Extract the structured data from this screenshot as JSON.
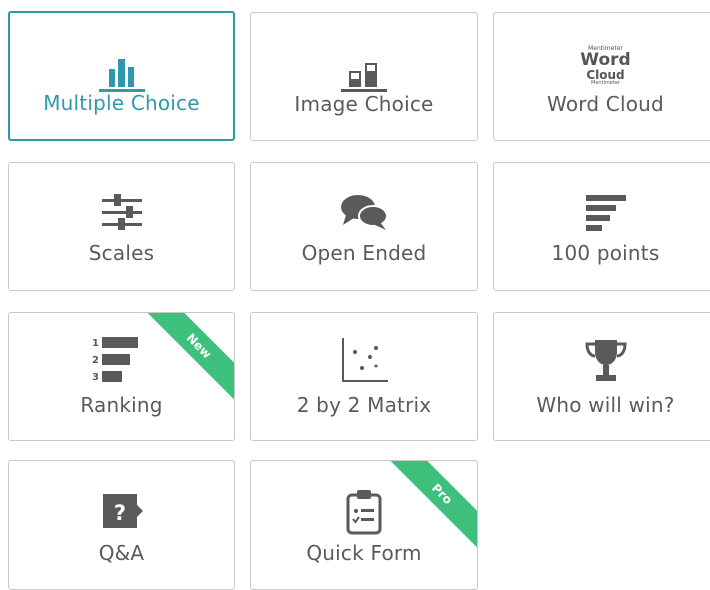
{
  "colors": {
    "accent": "#2e9aa9",
    "ribbon": "#3cc07b",
    "icon": "#555555",
    "border": "#c9c9c9"
  },
  "tiles": [
    {
      "label": "Multiple Choice",
      "icon": "bar-chart-icon",
      "selected": true
    },
    {
      "label": "Image Choice",
      "icon": "image-choice-icon"
    },
    {
      "label": "Word Cloud",
      "icon": "word-cloud-icon",
      "icon_text": {
        "line1": "Mentimeter",
        "line2": "Word",
        "line3": "Cloud",
        "line4": "Mentimeter"
      }
    },
    {
      "label": "Scales",
      "icon": "sliders-icon"
    },
    {
      "label": "Open Ended",
      "icon": "speech-bubbles-icon"
    },
    {
      "label": "100 points",
      "icon": "horizontal-bars-icon"
    },
    {
      "label": "Ranking",
      "icon": "ranking-icon",
      "badge": "New",
      "icon_numbers": [
        "1",
        "2",
        "3"
      ]
    },
    {
      "label": "2 by 2 Matrix",
      "icon": "scatter-plot-icon"
    },
    {
      "label": "Who will win?",
      "icon": "trophy-icon"
    },
    {
      "label": "Q&A",
      "icon": "question-bubble-icon",
      "icon_text": "?"
    },
    {
      "label": "Quick Form",
      "icon": "clipboard-icon",
      "badge": "Pro"
    }
  ]
}
